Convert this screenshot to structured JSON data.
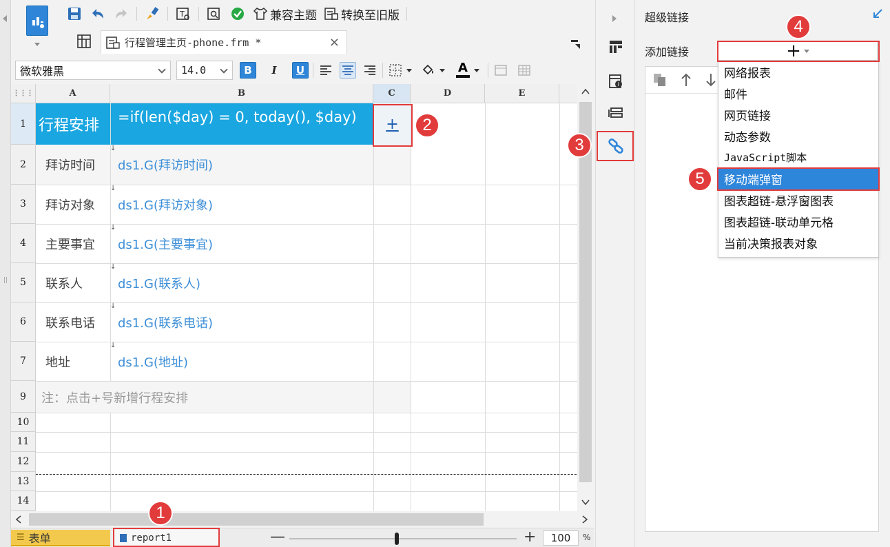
{
  "toolbar": {
    "compat_theme_label": "兼容主题",
    "convert_old_label": "转换至旧版"
  },
  "document_tab": {
    "title": "行程管理主页-phone.frm *",
    "close": "×"
  },
  "format_bar": {
    "font_name": "微软雅黑",
    "font_size": "14.0",
    "bold": "B",
    "italic": "I",
    "underline": "U",
    "font_color": "A"
  },
  "sheet": {
    "columns": [
      "A",
      "B",
      "C",
      "D",
      "E"
    ],
    "rows": [
      {
        "num": "1",
        "a": "行程安排",
        "b": "=if(len($day) = 0, today(), $day)",
        "c": "+"
      },
      {
        "num": "2",
        "a": "拜访时间",
        "b": "ds1.G(拜访时间)"
      },
      {
        "num": "3",
        "a": "拜访对象",
        "b": "ds1.G(拜访对象)"
      },
      {
        "num": "4",
        "a": "主要事宜",
        "b": "ds1.G(主要事宜)"
      },
      {
        "num": "5",
        "a": "联系人",
        "b": "ds1.G(联系人)"
      },
      {
        "num": "6",
        "a": "联系电话",
        "b": "ds1.G(联系电话)"
      },
      {
        "num": "7",
        "a": "地址",
        "b": "ds1.G(地址)"
      },
      {
        "num": "9",
        "a": "注：点击+号新增行程安排"
      },
      {
        "num": "10"
      },
      {
        "num": "11"
      },
      {
        "num": "12"
      },
      {
        "num": "13"
      },
      {
        "num": "14"
      }
    ]
  },
  "bottom": {
    "tab_form": "表单",
    "tab_report": "report1",
    "zoom_minus": "—",
    "zoom_plus": "+",
    "zoom_value": "100",
    "zoom_unit": "%",
    "zoom_level": 0.47
  },
  "panel": {
    "title": "超级链接",
    "add_link_label": "添加链接",
    "add_symbol": "+",
    "menu_items": [
      "网络报表",
      "邮件",
      "网页链接",
      "动态参数",
      "JavaScript脚本",
      "移动端弹窗",
      "图表超链-悬浮窗图表",
      "图表超链-联动单元格",
      "当前决策报表对象"
    ],
    "selected_item": "移动端弹窗"
  },
  "annotations": [
    "1",
    "2",
    "3",
    "4",
    "5"
  ],
  "colors": {
    "accent_blue": "#2e86db",
    "header_cell_bg": "#1aa6e0",
    "annotation_red": "#e23b3b",
    "form_tab_yellow": "#f2c94c",
    "ds_text_blue": "#3d8fd8"
  }
}
